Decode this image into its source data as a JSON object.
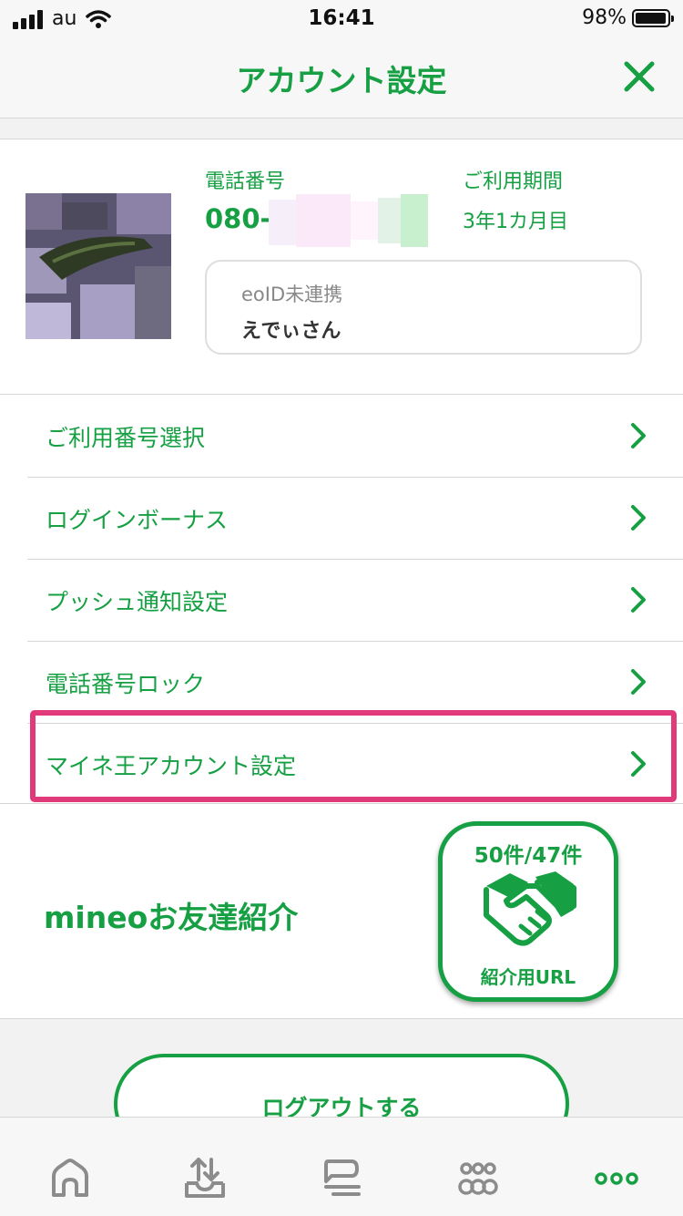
{
  "status_bar": {
    "carrier": "au",
    "time": "16:41",
    "battery": "98%",
    "battery_level": 0.98
  },
  "nav": {
    "title": "アカウント設定",
    "close_icon": "close-icon"
  },
  "profile": {
    "phone_label": "電話番号",
    "phone_value": "080-",
    "period_label": "ご利用期間",
    "period_value": "3年1カ月目",
    "eoid_status": "eoID未連携",
    "user_name": "えでぃさん"
  },
  "menu": {
    "items": [
      {
        "label": "ご利用番号選択"
      },
      {
        "label": "ログインボーナス"
      },
      {
        "label": "プッシュ通知設定"
      },
      {
        "label": "電話番号ロック"
      },
      {
        "label": "マイネ王アカウント設定"
      }
    ]
  },
  "referral": {
    "title": "mineoお友達紹介",
    "count": "50件/47件",
    "url_label": "紹介用URL",
    "icon": "handshake-icon"
  },
  "logout": {
    "label": "ログアウトする"
  },
  "tab_bar": {
    "tabs": [
      "home-icon",
      "upload-tray-icon",
      "chat-icon",
      "community-icon",
      "more-icon"
    ],
    "active": "more-icon"
  },
  "colors": {
    "accent": "#16a043",
    "highlight": "#e03a7a",
    "inactive_icon": "#8c8c8c"
  }
}
